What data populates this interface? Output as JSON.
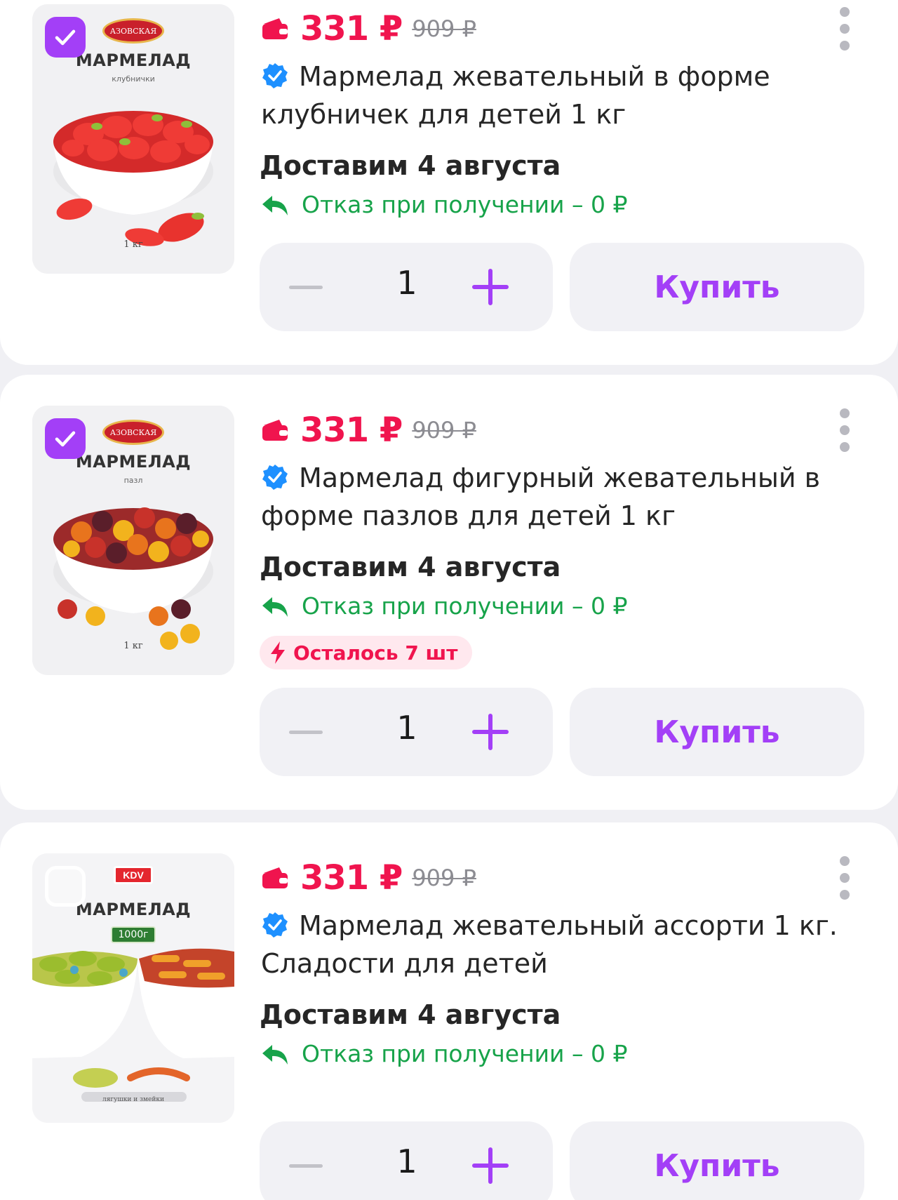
{
  "currency_symbol": "₽",
  "colors": {
    "accent": "#a33ff7",
    "price": "#f0144e",
    "green": "#17a34a",
    "verified": "#1e90ff"
  },
  "products": [
    {
      "selected": true,
      "brand": "АЗОВСКАЯ",
      "package_title": "МАРМЕЛАД",
      "package_subtitle": "клубнички",
      "package_weight": "1 кг",
      "price_now": "331 ₽",
      "price_old": "909 ₽",
      "title": "Мармелад жевательный в форме клубничек для детей 1 кг",
      "delivery": "Доставим 4 августа",
      "refusal": "Отказ при получении – 0 ₽",
      "quantity": "1",
      "buy_label": "Купить",
      "image_icon": "strawberry-gummies"
    },
    {
      "selected": true,
      "brand": "АЗОВСКАЯ",
      "package_title": "МАРМЕЛАД",
      "package_subtitle": "пазл",
      "package_weight": "1 кг",
      "price_now": "331 ₽",
      "price_old": "909 ₽",
      "title": "Мармелад фигурный жевательный в форме пазлов для детей 1 кг",
      "delivery": "Доставим 4 августа",
      "refusal": "Отказ при получении – 0 ₽",
      "stock_left": "Осталось 7 шт",
      "quantity": "1",
      "buy_label": "Купить",
      "image_icon": "puzzle-gummies"
    },
    {
      "selected": false,
      "brand": "KDV",
      "package_title": "МАРМЕЛАД",
      "package_weight_tag": "1000г",
      "package_caption": "лягушки и змейки",
      "price_now": "331 ₽",
      "price_old": "909 ₽",
      "title": "Мармелад жевательный ассорти 1 кг. Сладости для детей",
      "delivery": "Доставим 4 августа",
      "refusal": "Отказ при получении – 0 ₽",
      "quantity": "1",
      "buy_label": "Купить",
      "image_icon": "assorted-gummies"
    }
  ]
}
